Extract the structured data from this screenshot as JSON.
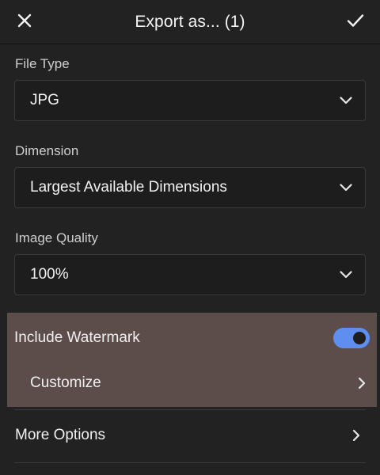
{
  "header": {
    "title": "Export as... (1)",
    "close_icon": "close-icon",
    "confirm_icon": "checkmark-icon"
  },
  "file_type": {
    "label": "File Type",
    "value": "JPG"
  },
  "dimension": {
    "label": "Dimension",
    "value": "Largest Available Dimensions"
  },
  "image_quality": {
    "label": "Image Quality",
    "value": "100%"
  },
  "watermark": {
    "label": "Include Watermark",
    "enabled": true,
    "customize_label": "Customize"
  },
  "more_options": {
    "label": "More Options"
  },
  "colors": {
    "background": "#222222",
    "highlight": "#5c4d4a",
    "toggle_on": "#5e8ef0"
  }
}
